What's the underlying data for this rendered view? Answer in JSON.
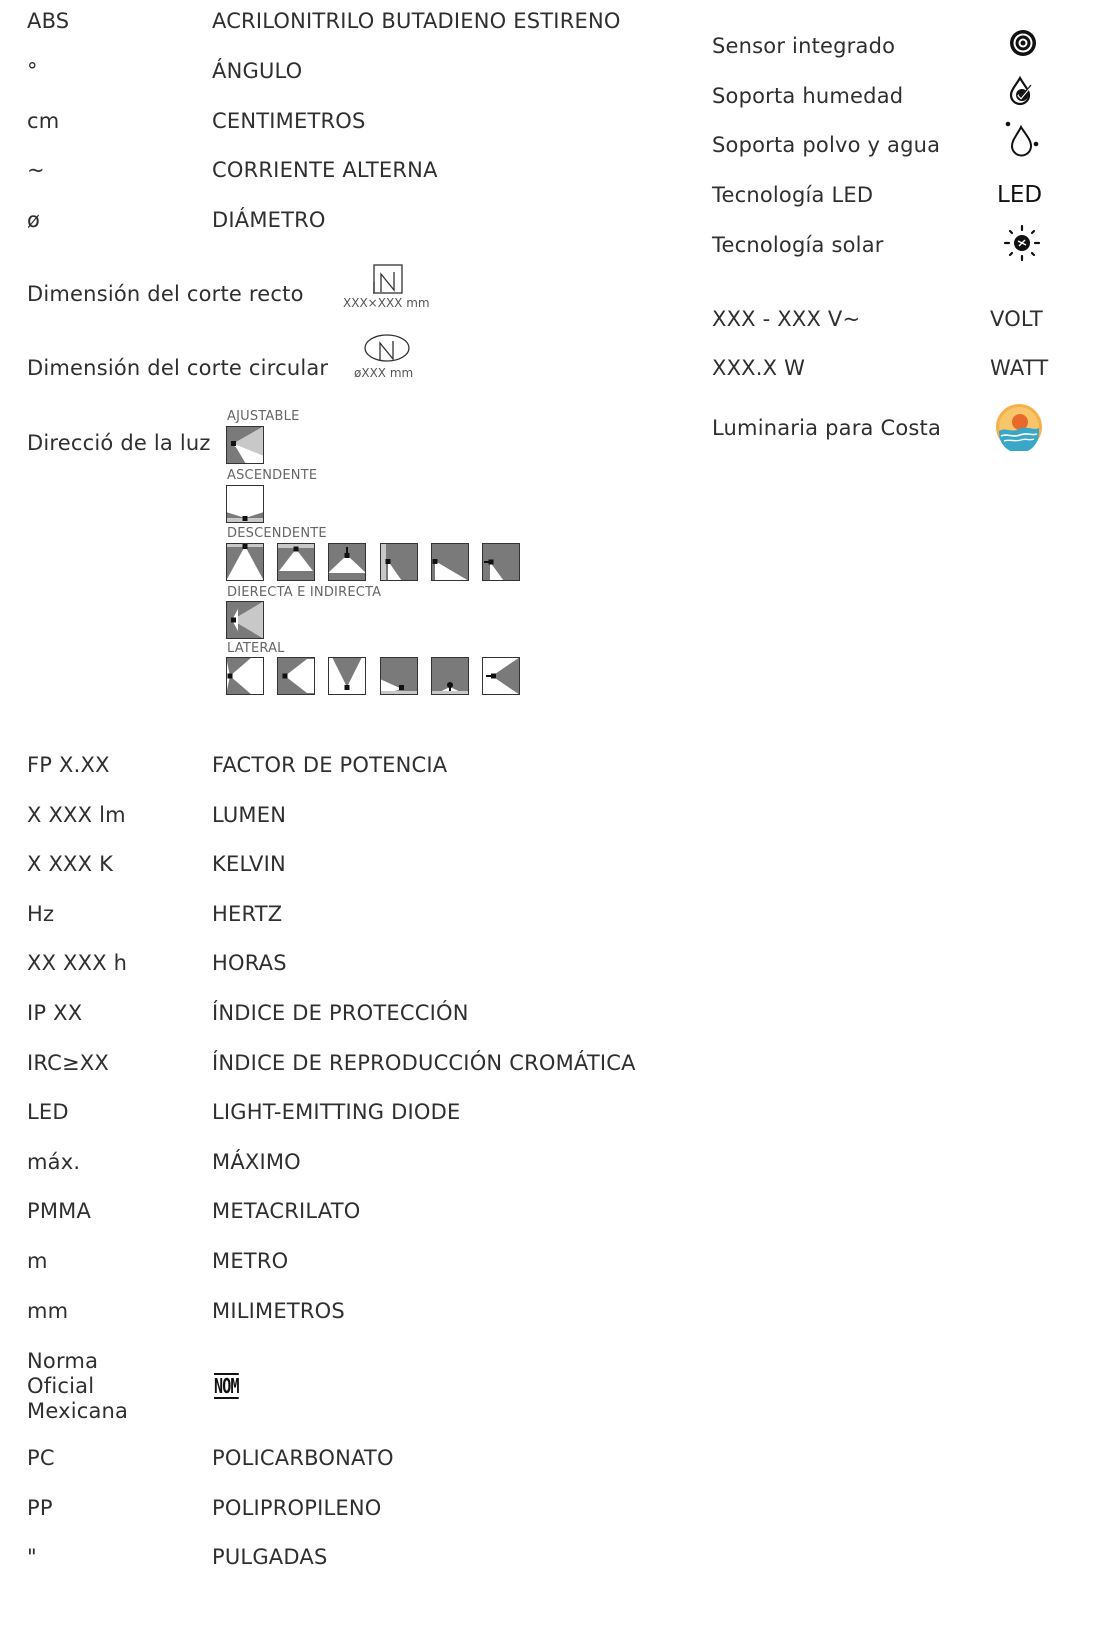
{
  "abbrev_top": [
    {
      "abbr": "ABS",
      "meaning": "ACRILONITRILO BUTADIENO ESTIRENO"
    },
    {
      "abbr": "°",
      "meaning": "ÁNGULO"
    },
    {
      "abbr": "cm",
      "meaning": "CENTIMETROS"
    },
    {
      "abbr": "~",
      "meaning": "CORRIENTE ALTERNA"
    },
    {
      "abbr": "ø",
      "meaning": "DIÁMETRO"
    }
  ],
  "cut_straight": {
    "label": "Dimensión del corte recto",
    "size": "XXX×XXX mm"
  },
  "cut_circular": {
    "label": "Dimensión del corte circular",
    "size": "øXXX mm"
  },
  "light_direction": {
    "label": "Direcció de la luz",
    "groups": [
      "AJUSTABLE",
      "ASCENDENTE",
      "DESCENDENTE",
      "DIERECTA E INDIRECTA",
      "LATERAL"
    ]
  },
  "abbrev_bottom": [
    {
      "abbr": "FP X.XX",
      "meaning": "FACTOR DE POTENCIA"
    },
    {
      "abbr": "X XXX lm",
      "meaning": "LUMEN"
    },
    {
      "abbr": "X XXX K",
      "meaning": "KELVIN"
    },
    {
      "abbr": "Hz",
      "meaning": "HERTZ"
    },
    {
      "abbr": "XX XXX h",
      "meaning": "HORAS"
    },
    {
      "abbr": "IP XX",
      "meaning": "ÍNDICE DE PROTECCIÓN"
    },
    {
      "abbr": "IRC≥XX",
      "meaning": "ÍNDICE DE REPRODUCCIÓN CROMÁTICA"
    },
    {
      "abbr": "LED",
      "meaning": "LIGHT-EMITTING DIODE"
    },
    {
      "abbr": "máx.",
      "meaning": "MÁXIMO"
    },
    {
      "abbr": "PMMA",
      "meaning": "METACRILATO"
    },
    {
      "abbr": "m",
      "meaning": "METRO"
    },
    {
      "abbr": "mm",
      "meaning": "MILIMETROS"
    }
  ],
  "nom": {
    "abbr_lines": [
      "Norma",
      "Oficial",
      "Mexicana"
    ],
    "logo_text": "NOM"
  },
  "abbrev_end": [
    {
      "abbr": "PC",
      "meaning": "POLICARBONATO"
    },
    {
      "abbr": "PP",
      "meaning": "POLIPROPILENO"
    },
    {
      "abbr": "\"",
      "meaning": "PULGADAS"
    }
  ],
  "features": [
    {
      "label": "Sensor integrado",
      "icon": "sensor-icon"
    },
    {
      "label": "Soporta humedad",
      "icon": "humidity-icon"
    },
    {
      "label": "Soporta polvo y agua",
      "icon": "dust-water-icon"
    },
    {
      "label": "Tecnología LED",
      "icon_text": "LED"
    },
    {
      "label": "Tecnología solar",
      "icon": "solar-icon"
    }
  ],
  "electrical": [
    {
      "label": "XXX - XXX V~",
      "meaning": "VOLT"
    },
    {
      "label": "XXX.X W",
      "meaning": "WATT"
    }
  ],
  "coast": {
    "label": "Luminaria para Costa",
    "icon": "coast-icon"
  },
  "colors": {
    "text": "#2f2f2f",
    "diagram_gray": "#7a7a7a",
    "diagram_light": "#c8c8c8",
    "coast_orange": "#f0a33a",
    "coast_blue": "#3aa7c9"
  }
}
